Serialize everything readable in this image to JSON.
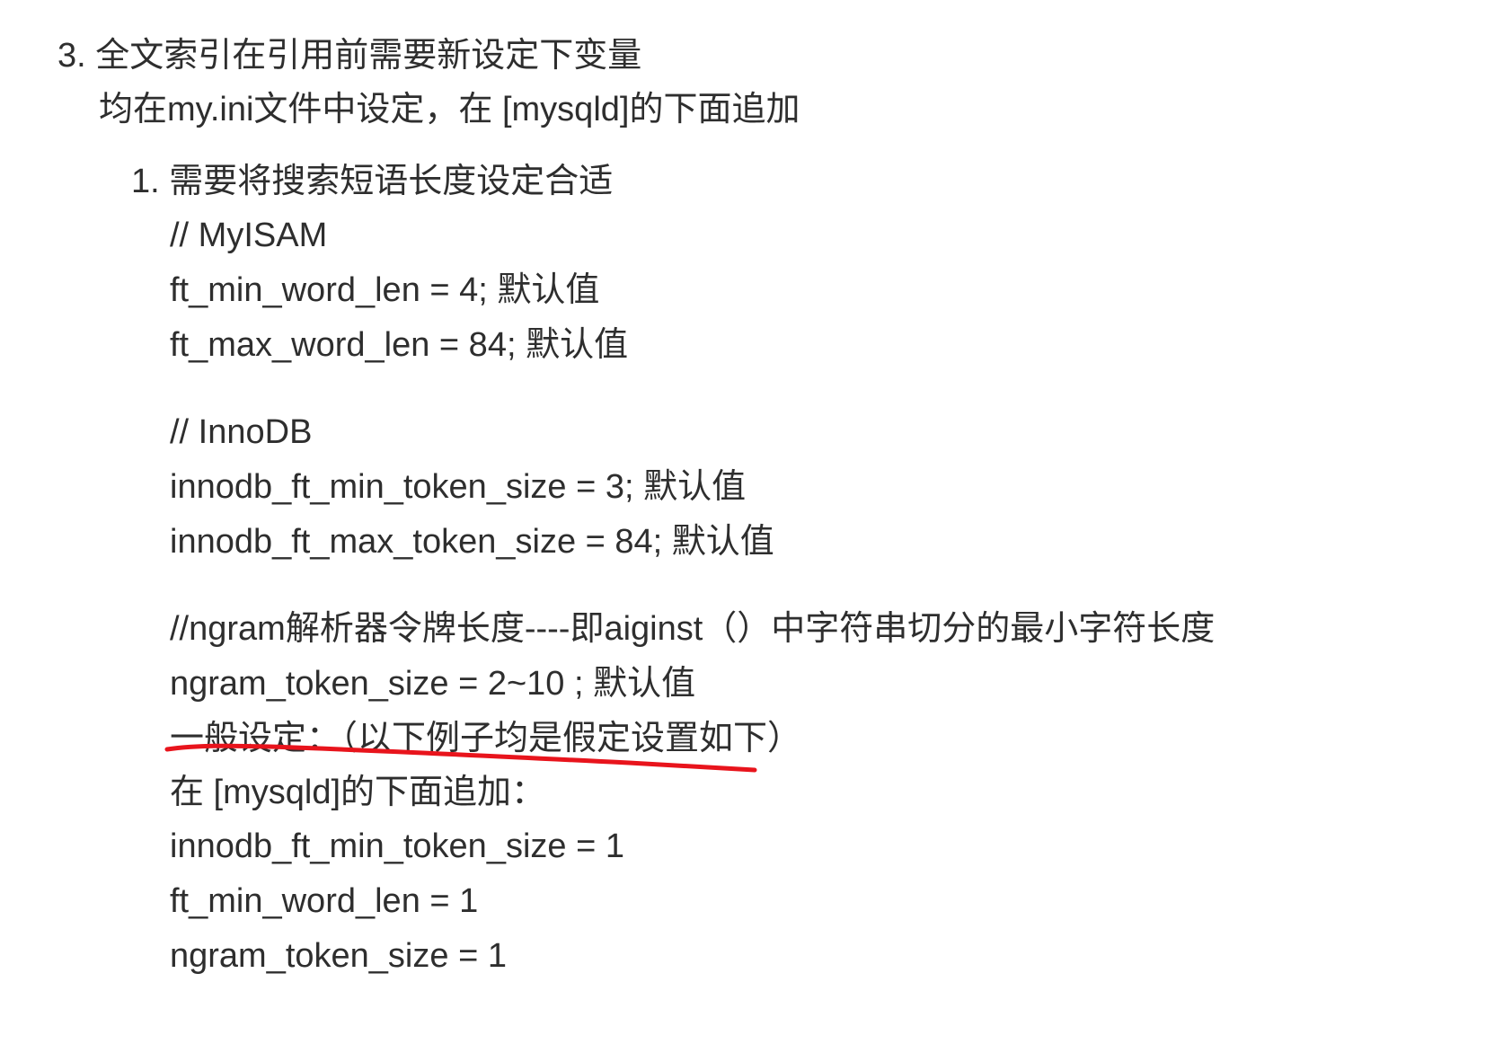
{
  "section": {
    "heading": "3. 全文索引在引用前需要新设定下变量",
    "intro": "均在my.ini文件中设定，在 [mysqld]的下面追加"
  },
  "subsection": {
    "heading": "1. 需要将搜索短语长度设定合适"
  },
  "myisam": {
    "comment": "// MyISAM",
    "line1": "ft_min_word_len = 4; 默认值",
    "line2": "ft_max_word_len = 84; 默认值"
  },
  "innodb": {
    "comment": "// InnoDB",
    "line1": "innodb_ft_min_token_size = 3; 默认值",
    "line2": "innodb_ft_max_token_size = 84; 默认值"
  },
  "ngram": {
    "comment": "//ngram解析器令牌长度----即aiginst（）中字符串切分的最小字符长度",
    "line": "ngram_token_size = 2~10 ; 默认值"
  },
  "general": {
    "heading": "一般设定：（以下例子均是假定设置如下）",
    "append": "在 [mysqld]的下面追加：",
    "line1": "innodb_ft_min_token_size = 1",
    "line2": "ft_min_word_len = 1",
    "line3": "ngram_token_size = 1"
  },
  "colors": {
    "text": "#2e2e2e",
    "annotation": "#e8141c",
    "background": "#ffffff"
  }
}
